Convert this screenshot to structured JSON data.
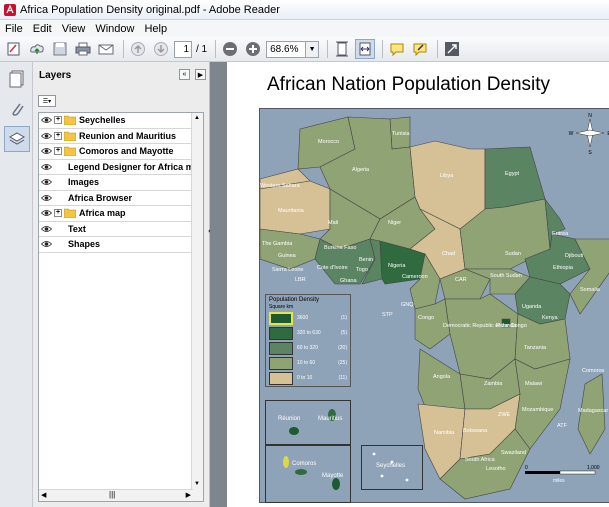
{
  "window": {
    "title": "Africa Population Density original.pdf - Adobe Reader"
  },
  "menu": [
    "File",
    "Edit",
    "View",
    "Window",
    "Help"
  ],
  "toolbar": {
    "page_current": "1",
    "page_total": "/ 1",
    "zoom": "68.6%"
  },
  "layers_panel": {
    "title": "Layers",
    "items": [
      {
        "label": "Seychelles",
        "expandable": true,
        "folder": true
      },
      {
        "label": "Reunion and Mauritius",
        "expandable": true,
        "folder": true
      },
      {
        "label": "Comoros and Mayotte",
        "expandable": true,
        "folder": true
      },
      {
        "label": "Legend Designer for Africa map",
        "expandable": false,
        "folder": false
      },
      {
        "label": "Images",
        "expandable": false,
        "folder": false
      },
      {
        "label": "Africa Browser",
        "expandable": false,
        "folder": false
      },
      {
        "label": "Africa map",
        "expandable": true,
        "folder": true
      },
      {
        "label": "Text",
        "expandable": false,
        "folder": false
      },
      {
        "label": "Shapes",
        "expandable": false,
        "folder": false
      }
    ]
  },
  "document": {
    "map_title": "African Nation Population Density",
    "legend": {
      "title": "Population Density",
      "subtitle": "Square km",
      "rows": [
        {
          "range": "3600",
          "count": "(1)",
          "color": "#1d5a2f"
        },
        {
          "range": "320  to  630",
          "count": "(5)",
          "color": "#2f6b3e"
        },
        {
          "range": "60  to  320",
          "count": "(20)",
          "color": "#5b8463"
        },
        {
          "range": "10  to   60",
          "count": "(25)",
          "color": "#8fa374"
        },
        {
          "range": "0   to   10",
          "count": "(11)",
          "color": "#d6c197"
        }
      ]
    },
    "countries": [
      "Morocco",
      "Tunisia",
      "Algeria",
      "Libya",
      "Egypt",
      "Western Sahara",
      "Mauritania",
      "Mali",
      "Niger",
      "Chad",
      "Sudan",
      "Eritrea",
      "Djibouti",
      "Ethiopia",
      "Somalia",
      "The Gambia",
      "Guinea",
      "Sierra Leone",
      "LBR",
      "Burkina Faso",
      "Cote d'Ivoire",
      "Ghana",
      "Benin",
      "Togo",
      "Nigeria",
      "Cameroon",
      "CAR",
      "South Sudan",
      "Uganda",
      "Kenya",
      "Rwanda",
      "Tanzania",
      "STP",
      "GNQ",
      "Congo",
      "Democratic Republic of the Congo",
      "Angola",
      "Zambia",
      "Malawi",
      "Comoros",
      "ZWE",
      "Mozambique",
      "Madagascar",
      "ATF",
      "Namibia",
      "Botswana",
      "Swaziland",
      "South Africa",
      "Lesotho",
      "Réunion",
      "Mauritius",
      "Mayotte",
      "Seychelles"
    ],
    "scale": {
      "zero": "0",
      "max": "1,000",
      "unit": "miles"
    },
    "compass": {
      "n": "N",
      "s": "S",
      "e": "E",
      "w": "W"
    }
  },
  "colors": {
    "very_high": "#1d5a2f",
    "high": "#2f6b3e",
    "medium": "#5b8463",
    "low": "#8fa374",
    "very_low": "#d6c197",
    "water": "#8ea2b8"
  }
}
